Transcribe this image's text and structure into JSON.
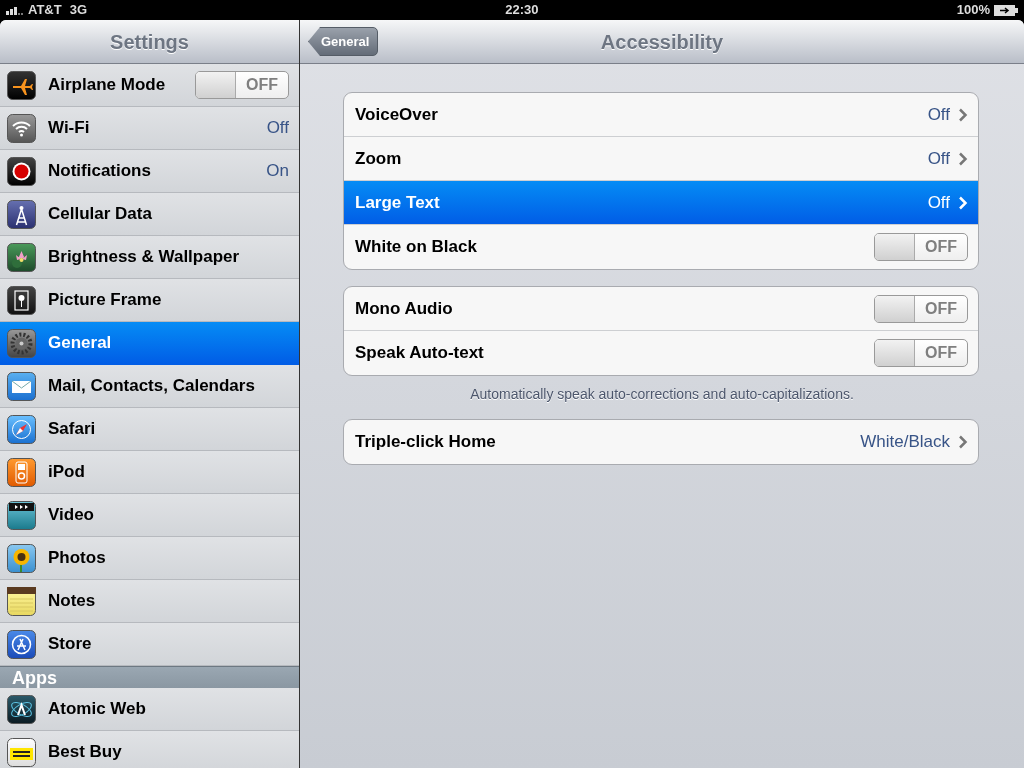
{
  "status_bar": {
    "carrier": "AT&T",
    "network": "3G",
    "time": "22:30",
    "battery": "100%"
  },
  "sidebar": {
    "title": "Settings",
    "sections": [
      {
        "items": [
          {
            "label": "Airplane Mode",
            "kind": "toggle",
            "on": false,
            "toggle_text": "OFF",
            "selected": false
          },
          {
            "label": "Wi-Fi",
            "kind": "value",
            "value": "Off",
            "selected": false
          },
          {
            "label": "Notifications",
            "kind": "value",
            "value": "On",
            "selected": false
          },
          {
            "label": "Cellular Data",
            "kind": "plain",
            "selected": false
          },
          {
            "label": "Brightness & Wallpaper",
            "kind": "plain",
            "selected": false
          },
          {
            "label": "Picture Frame",
            "kind": "plain",
            "selected": false
          },
          {
            "label": "General",
            "kind": "plain",
            "selected": true
          },
          {
            "label": "Mail, Contacts, Calendars",
            "kind": "plain",
            "selected": false
          },
          {
            "label": "Safari",
            "kind": "plain",
            "selected": false
          },
          {
            "label": "iPod",
            "kind": "plain",
            "selected": false
          },
          {
            "label": "Video",
            "kind": "plain",
            "selected": false
          },
          {
            "label": "Photos",
            "kind": "plain",
            "selected": false
          },
          {
            "label": "Notes",
            "kind": "plain",
            "selected": false
          },
          {
            "label": "Store",
            "kind": "plain",
            "selected": false
          }
        ]
      },
      {
        "header": "Apps",
        "items": [
          {
            "label": "Atomic Web",
            "kind": "plain",
            "selected": false
          },
          {
            "label": "Best Buy",
            "kind": "plain",
            "selected": false
          }
        ]
      }
    ]
  },
  "detail": {
    "back_button": "General",
    "title": "Accessibility",
    "groups": [
      {
        "rows": [
          {
            "label": "VoiceOver",
            "kind": "disclosure",
            "value": "Off",
            "selected": false
          },
          {
            "label": "Zoom",
            "kind": "disclosure",
            "value": "Off",
            "selected": false
          },
          {
            "label": "Large Text",
            "kind": "disclosure",
            "value": "Off",
            "selected": true
          },
          {
            "label": "White on Black",
            "kind": "toggle",
            "on": false,
            "toggle_text": "OFF",
            "selected": false
          }
        ]
      },
      {
        "rows": [
          {
            "label": "Mono Audio",
            "kind": "toggle",
            "on": false,
            "toggle_text": "OFF",
            "selected": false
          },
          {
            "label": "Speak Auto-text",
            "kind": "toggle",
            "on": false,
            "toggle_text": "OFF",
            "selected": false
          }
        ],
        "footer": "Automatically speak auto-corrections and auto-capitalizations."
      },
      {
        "rows": [
          {
            "label": "Triple-click Home",
            "kind": "disclosure",
            "value": "White/Black",
            "selected": false
          }
        ]
      }
    ]
  }
}
